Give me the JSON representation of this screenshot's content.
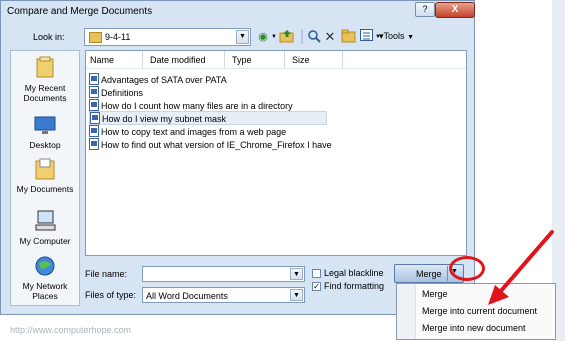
{
  "window": {
    "title": "Compare and Merge Documents",
    "help_label": "?",
    "close_label": "X"
  },
  "toolbar": {
    "look_in_label": "Look in:",
    "look_in_value": "9-4-11",
    "tools_label": "Tools"
  },
  "places": [
    {
      "label": "My Recent Documents",
      "icon": "recent-documents-icon"
    },
    {
      "label": "Desktop",
      "icon": "desktop-icon"
    },
    {
      "label": "My Documents",
      "icon": "my-documents-icon"
    },
    {
      "label": "My Computer",
      "icon": "my-computer-icon"
    },
    {
      "label": "My Network Places",
      "icon": "network-places-icon"
    }
  ],
  "columns": [
    "Name",
    "Date modified",
    "Type",
    "Size"
  ],
  "files": [
    "Advantages of SATA over PATA",
    "Definitions",
    "How do I count how many files are in a directory",
    "How do I view my subnet mask",
    "How to copy text and images from a web page",
    "How to find out what version of IE_Chrome_Firefox I have"
  ],
  "selected_file_index": 3,
  "form": {
    "file_name_label": "File name:",
    "file_name_value": "",
    "files_of_type_label": "Files of type:",
    "files_of_type_value": "All Word Documents",
    "legal_blackline_label": "Legal blackline",
    "legal_blackline_checked": false,
    "find_formatting_label": "Find formatting",
    "find_formatting_checked": true
  },
  "merge_button": {
    "label": "Merge"
  },
  "merge_menu": [
    "Merge",
    "Merge into current document",
    "Merge into new document"
  ],
  "watermark": "http://www.computerhope.com",
  "colors": {
    "dialog_bg": "#d6e4f4",
    "highlight": "#e0141a",
    "close_button": "#c2412a"
  }
}
